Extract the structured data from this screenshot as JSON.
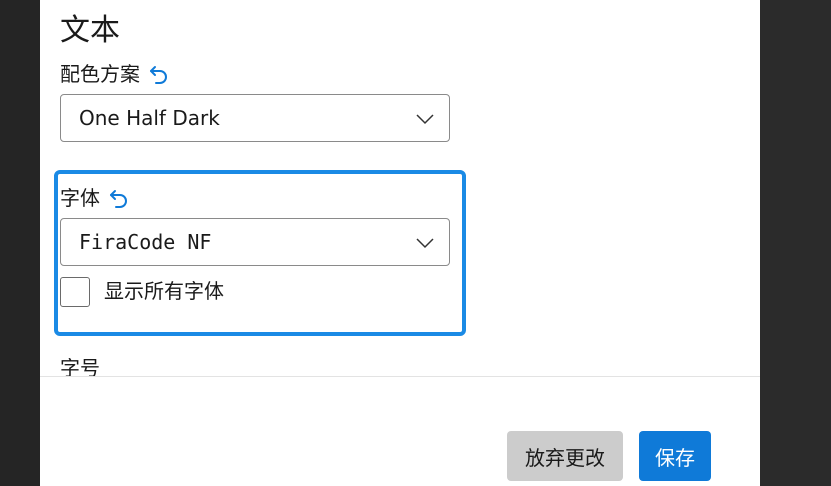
{
  "section": {
    "title": "文本"
  },
  "color_scheme": {
    "label": "配色方案",
    "value": "One Half Dark",
    "icons": {
      "reset": "reset-undo-icon",
      "dropdown": "chevron-down-icon"
    }
  },
  "font_face": {
    "label": "字体",
    "value": "FiraCode NF",
    "icons": {
      "reset": "reset-undo-icon",
      "dropdown": "chevron-down-icon"
    },
    "show_all_label": "显示所有字体",
    "show_all_checked": false
  },
  "font_size": {
    "label": "字号"
  },
  "footer": {
    "discard_label": "放弃更改",
    "save_label": "保存"
  },
  "colors": {
    "accent": "#0f7ad8",
    "focus_border": "#1a8ae5",
    "discard_bg": "#cccccc",
    "window_bg": "#2b2b2b",
    "panel_bg": "#ffffff"
  }
}
